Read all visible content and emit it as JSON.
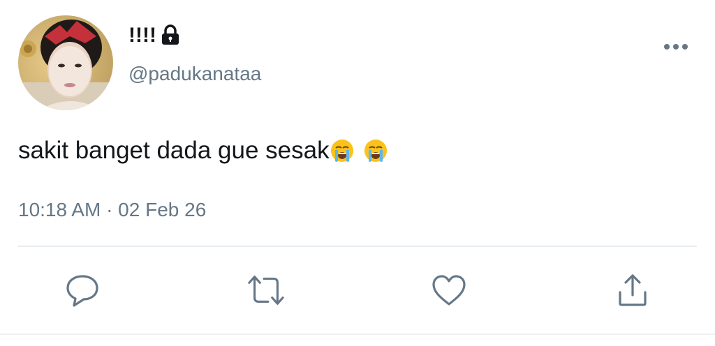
{
  "tweet": {
    "display_name": "!!!!",
    "handle": "@padukanataa",
    "text": "sakit banget dada gue sesak",
    "emojis": [
      "loudly-crying-face",
      "loudly-crying-face"
    ],
    "timestamp": "10:18 AM · 02 Feb 26",
    "protected_icon": "lock-icon",
    "more_icon": "ellipsis-icon"
  },
  "actions": [
    {
      "name": "reply",
      "icon": "reply-icon"
    },
    {
      "name": "retweet",
      "icon": "retweet-icon"
    },
    {
      "name": "like",
      "icon": "heart-icon"
    },
    {
      "name": "share",
      "icon": "share-icon"
    }
  ],
  "colors": {
    "text": "#14171a",
    "secondary": "#657786",
    "divider": "#e6ecf0",
    "background": "#ffffff"
  }
}
